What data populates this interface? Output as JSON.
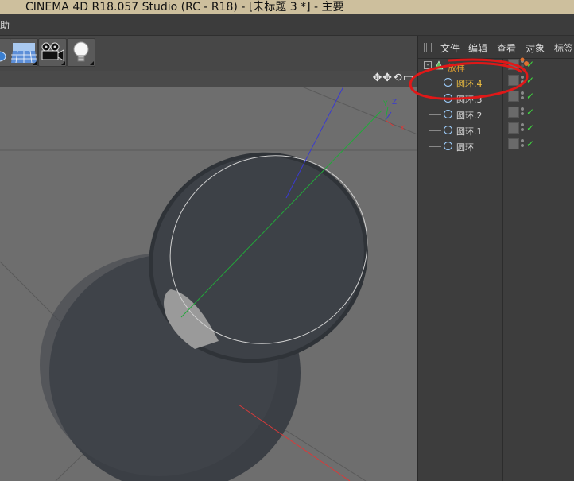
{
  "window": {
    "title": "CINEMA 4D R18.057 Studio (RC - R18) - [未标题 3 *] - 主要"
  },
  "menubar": {
    "help_fragment": "助"
  },
  "toolbar": {
    "buttons": [
      {
        "icon": "deformer-icon"
      },
      {
        "icon": "floor-grid-icon"
      },
      {
        "icon": "camera-icon"
      },
      {
        "icon": "light-bulb-icon"
      }
    ]
  },
  "viewport": {
    "nav_icons": "✥✥⟲▭",
    "axis_labels": {
      "x": "X",
      "y": "Y",
      "z": "Z"
    },
    "colors": {
      "x_axis": "#d83a3a",
      "y_axis": "#22a83a",
      "z_axis": "#3a3ad0",
      "background": "#6e6e6e",
      "object": "#3b3f45"
    }
  },
  "object_manager": {
    "menu": [
      "文件",
      "编辑",
      "查看",
      "对象",
      "标签"
    ],
    "objects": [
      {
        "name": "放样",
        "type": "loft",
        "color": "#e0a030",
        "expanded": true
      },
      {
        "name": "圆环.4",
        "type": "circle",
        "color": "#f0c040",
        "selected": true
      },
      {
        "name": "圆环.3",
        "type": "circle",
        "color": "#d8d8d8"
      },
      {
        "name": "圆环.2",
        "type": "circle",
        "color": "#d8d8d8"
      },
      {
        "name": "圆环.1",
        "type": "circle",
        "color": "#d8d8d8"
      },
      {
        "name": "圆环",
        "type": "circle",
        "color": "#d8d8d8"
      }
    ],
    "annotation_color": "#e01818"
  }
}
